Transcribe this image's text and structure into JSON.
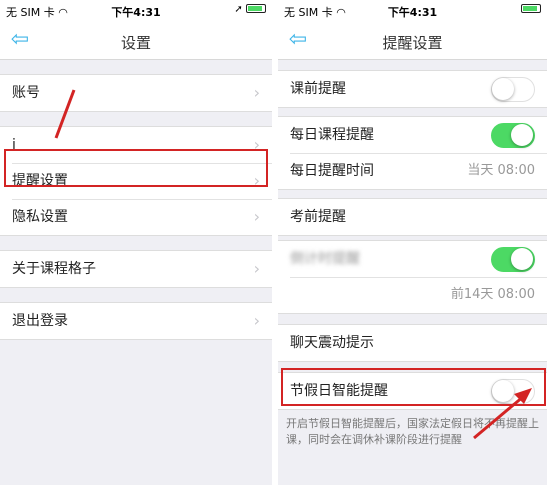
{
  "left": {
    "status": {
      "carrier": "无 SIM 卡",
      "time": "下午4:31"
    },
    "title": "设置",
    "items": [
      {
        "label": "账号"
      },
      {
        "label": "i"
      },
      {
        "label": "提醒设置"
      },
      {
        "label": "隐私设置"
      },
      {
        "label": "关于课程格子"
      },
      {
        "label": "退出登录"
      }
    ],
    "colors": {
      "accent": "#3fb5e8",
      "highlight": "#d32424"
    }
  },
  "right": {
    "status": {
      "carrier": "无 SIM 卡",
      "time": "下午4:31"
    },
    "title": "提醒设置",
    "items": [
      {
        "label": "课前提醒",
        "toggle": "off"
      },
      {
        "label": "每日课程提醒",
        "toggle": "on"
      },
      {
        "label": "每日提醒时间",
        "value": "当天 08:00"
      },
      {
        "label": "考前提醒"
      },
      {
        "label": "倒计时提醒",
        "toggle": "on"
      },
      {
        "value": "前14天 08:00"
      },
      {
        "label": "聊天震动提示"
      },
      {
        "label": "节假日智能提醒",
        "toggle": "off"
      }
    ],
    "note": "开启节假日智能提醒后，国家法定假日将不再提醒上课，同时会在调休补课阶段进行提醒",
    "colors": {
      "toggle_on": "#4cd964"
    }
  },
  "icons": {
    "back": "back-arrow-icon",
    "chevron": "chevron-right-icon",
    "wifi": "wifi-icon",
    "location": "location-arrow-icon",
    "battery": "battery-icon",
    "annotation": "red-arrow-annotation"
  }
}
